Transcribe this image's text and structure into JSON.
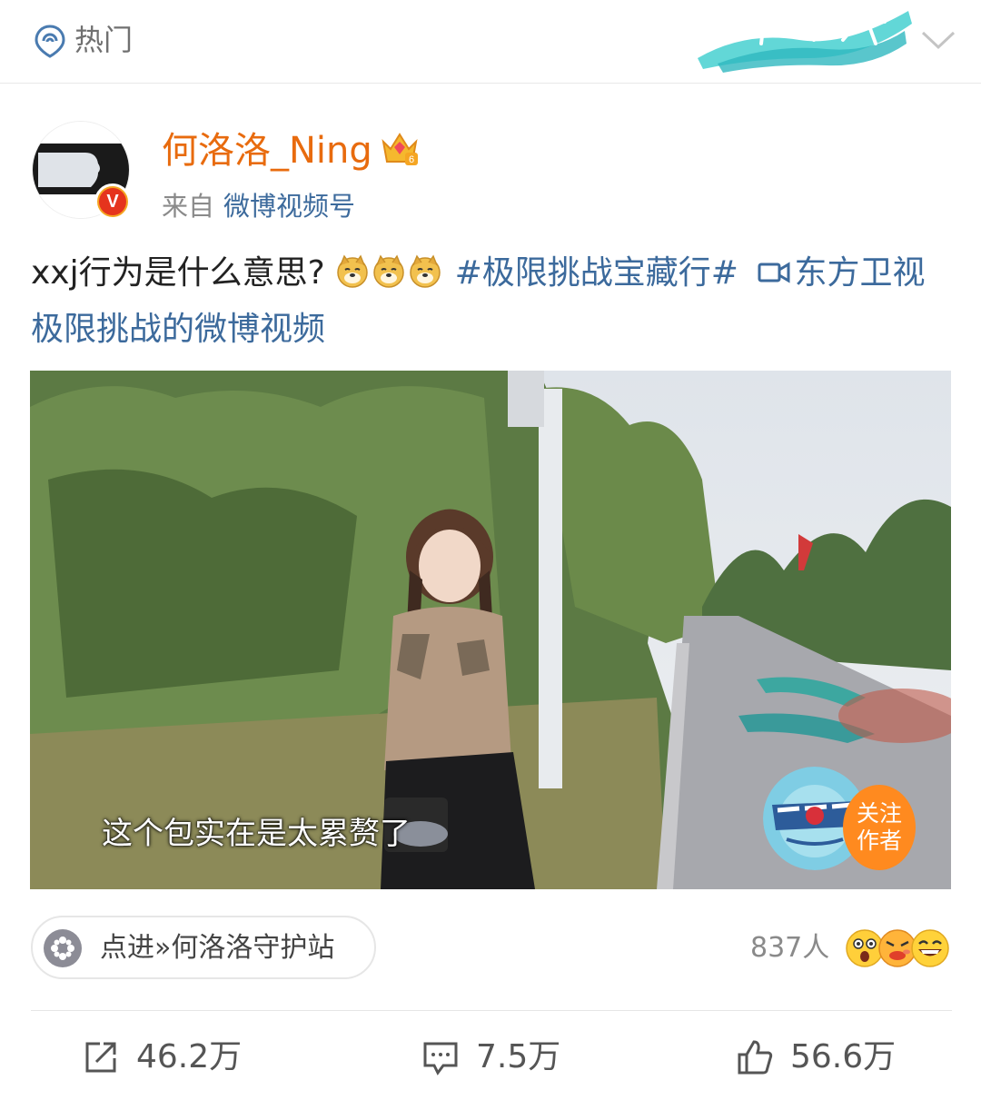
{
  "header": {
    "hot_label": "热门",
    "hot_icon": "hot-location-icon",
    "banner_icon": "campaign-banner-icon",
    "collapse_icon": "chevron-down-icon"
  },
  "author": {
    "name": "何洛洛_Ning",
    "from_label": "来自",
    "source": "微博视频号",
    "verified_badge": "V",
    "crown_badge": "6"
  },
  "post": {
    "text": "xxj行为是什么意思?",
    "emojis": [
      "doge-emoji",
      "doge-emoji",
      "doge-emoji"
    ],
    "topic": "#极限挑战宝藏行#",
    "video_link": "东方卫视极限挑战的微博视频"
  },
  "video": {
    "subtitle": "这个包实在是太累赘了",
    "follow_line1": "关注",
    "follow_line2": "作者"
  },
  "super_topic": {
    "label": "点进»何洛洛守护站"
  },
  "reactions": {
    "count": "837人",
    "emojis": [
      "surprised-emoji",
      "angry-emoji",
      "laugh-emoji"
    ]
  },
  "actions": {
    "repost": "46.2万",
    "comment": "7.5万",
    "like": "56.6万"
  },
  "colors": {
    "author_name": "#e86b0e",
    "link_blue": "#3c6a9c",
    "follow_orange": "#ff8a1f",
    "banner_teal": "#3cc8c8"
  }
}
